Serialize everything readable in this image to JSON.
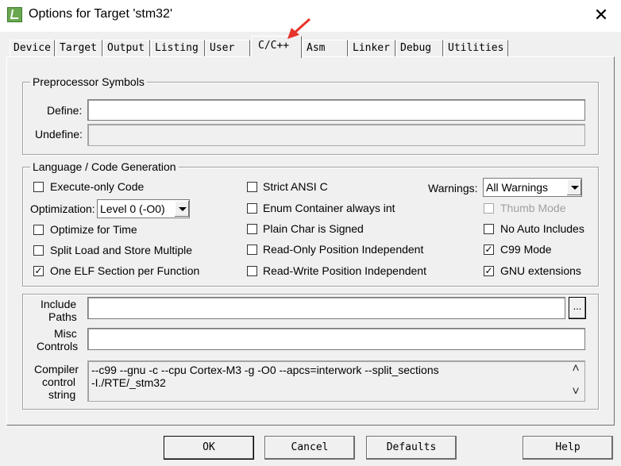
{
  "window": {
    "title": "Options for Target 'stm32'",
    "close_glyph": "✕"
  },
  "tabs": [
    "Device",
    "Target",
    "Output",
    "Listing",
    "User",
    "C/C++",
    "Asm",
    "Linker",
    "Debug",
    "Utilities"
  ],
  "active_tab": "C/C++",
  "preprocessor": {
    "legend": "Preprocessor Symbols",
    "define_label": "Define:",
    "define_value": "",
    "undefine_label": "Undefine:",
    "undefine_value": ""
  },
  "language": {
    "legend": "Language / Code Generation",
    "execute_only": {
      "label": "Execute-only Code",
      "checked": false
    },
    "optimization_label": "Optimization:",
    "optimization_value": "Level 0 (-O0)",
    "optimize_time": {
      "label": "Optimize for Time",
      "checked": false
    },
    "split_load": {
      "label": "Split Load and Store Multiple",
      "checked": false
    },
    "one_elf": {
      "label": "One ELF Section per Function",
      "checked": true
    },
    "strict_ansi": {
      "label": "Strict ANSI C",
      "checked": false
    },
    "enum_int": {
      "label": "Enum Container always int",
      "checked": false
    },
    "plain_char": {
      "label": "Plain Char is Signed",
      "checked": false
    },
    "ro_pi": {
      "label": "Read-Only Position Independent",
      "checked": false
    },
    "rw_pi": {
      "label": "Read-Write Position Independent",
      "checked": false
    },
    "warnings_label": "Warnings:",
    "warnings_value": "All Warnings",
    "thumb_mode": {
      "label": "Thumb Mode",
      "checked": false,
      "disabled": true
    },
    "no_auto_includes": {
      "label": "No Auto Includes",
      "checked": false
    },
    "c99_mode": {
      "label": "C99 Mode",
      "checked": true
    },
    "gnu_ext": {
      "label": "GNU extensions",
      "checked": true
    }
  },
  "paths": {
    "include_label_1": "Include",
    "include_label_2": "Paths",
    "include_value": "",
    "browse_label": "...",
    "misc_label_1": "Misc",
    "misc_label_2": "Controls",
    "misc_value": "",
    "compiler_label_1": "Compiler",
    "compiler_label_2": "control",
    "compiler_label_3": "string",
    "compiler_line_1": "--c99 --gnu -c --cpu Cortex-M3 -g -O0 --apcs=interwork --split_sections",
    "compiler_line_2": "-I./RTE/_stm32"
  },
  "buttons": {
    "ok": "OK",
    "cancel": "Cancel",
    "defaults": "Defaults",
    "help": "Help"
  },
  "icons": {
    "app": "keil-uvision-icon",
    "check_glyph": "✓",
    "scroll_up": "˄",
    "scroll_down": "˅"
  },
  "colors": {
    "dialog_bg": "#f0f0f0",
    "annotation_arrow": "#e8332a"
  }
}
